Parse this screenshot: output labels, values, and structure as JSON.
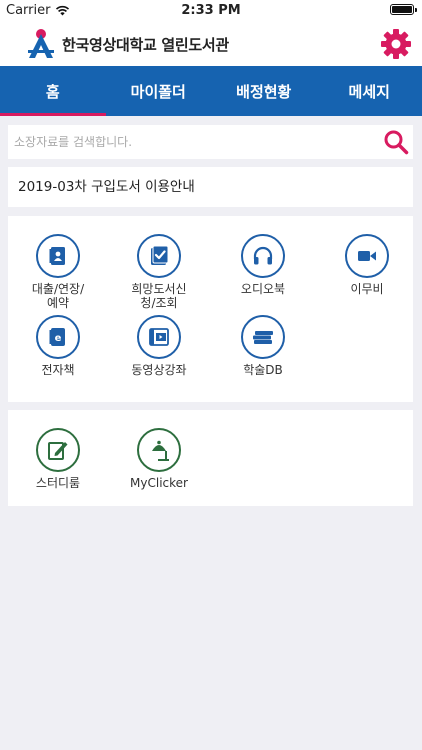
{
  "status_bar": {
    "carrier": "Carrier",
    "time": "2:33 PM"
  },
  "header": {
    "title": "한국영상대학교 열린도서관"
  },
  "tabs": [
    {
      "label": "홈",
      "active": true
    },
    {
      "label": "마이폴더"
    },
    {
      "label": "배정현황"
    },
    {
      "label": "메세지"
    }
  ],
  "search": {
    "placeholder": "소장자료를 검색합니다."
  },
  "notice": {
    "text": "2019-03차 구입도서 이용안내"
  },
  "menu": [
    {
      "label": "대출/연장/\n예약",
      "icon": "contact-book-icon"
    },
    {
      "label": "희망도서신\n청/조회",
      "icon": "checklist-book-icon"
    },
    {
      "label": "오디오북",
      "icon": "headphones-icon"
    },
    {
      "label": "이무비",
      "icon": "video-camera-icon"
    },
    {
      "label": "전자책",
      "icon": "ebook-icon"
    },
    {
      "label": "동영상강좌",
      "icon": "video-lecture-icon"
    },
    {
      "label": "학술DB",
      "icon": "book-stack-icon"
    }
  ],
  "extra_menu": [
    {
      "label": "스터디룸",
      "icon": "pencil-note-icon"
    },
    {
      "label": "MyClicker",
      "icon": "desk-lamp-icon"
    }
  ],
  "colors": {
    "tab_bar": "#1663b0",
    "tab_active_indicator": "#d81b60",
    "icon_blue": "#1f5fa8",
    "icon_green": "#2d6e3e",
    "settings": "#d81b60"
  }
}
